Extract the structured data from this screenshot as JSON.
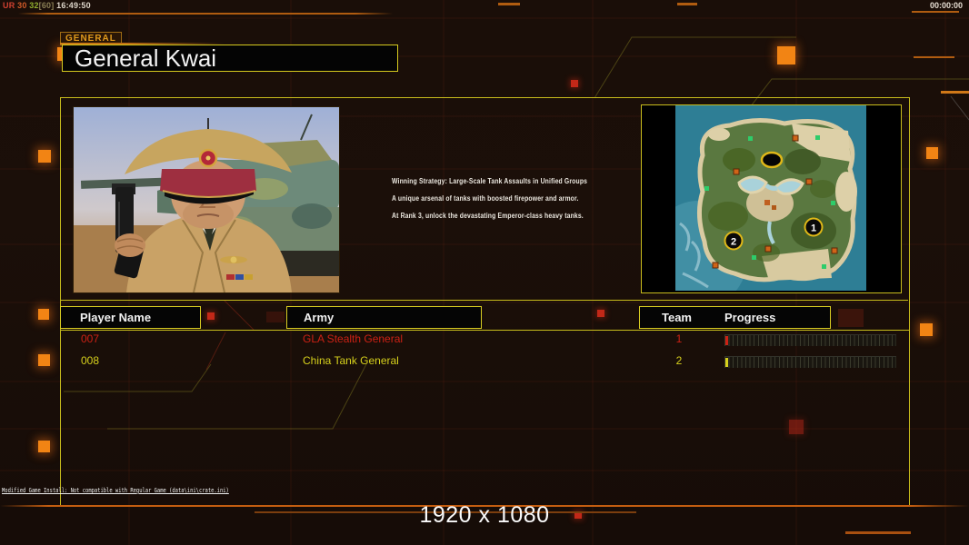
{
  "hud": {
    "debug": {
      "label1": "UR",
      "fps": "30",
      "value": "32",
      "max": "[60]",
      "clock": "16:49:50"
    },
    "match_timer": "00:00:00"
  },
  "header": {
    "tab": "GENERAL",
    "title": "General Kwai"
  },
  "briefing": {
    "lines": [
      "Winning Strategy: Large-Scale Tank Assaults in Unified Groups",
      "A unique arsenal of tanks with boosted firepower and armor.",
      "At Rank 3, unlock the devastating Emperor-class heavy tanks."
    ]
  },
  "map_preview": {
    "marker1": "1",
    "marker2": "2"
  },
  "player_table": {
    "headers": {
      "name": "Player Name",
      "army": "Army",
      "team": "Team",
      "progress": "Progress"
    },
    "rows": [
      {
        "name": "007",
        "army": "GLA Stealth General",
        "team": "1",
        "color": "#cc2114",
        "progress_percent": 2
      },
      {
        "name": "008",
        "army": "China Tank General",
        "team": "2",
        "color": "#d6d01c",
        "progress_percent": 2
      }
    ]
  },
  "status_bar": {
    "message": "Modified Game Install: Not compatible with Regular Game (data\\ini\\crate.ini)"
  },
  "footer": {
    "resolution": "1920 x 1080"
  },
  "theme": {
    "frame_yellow": "#c8bc1c",
    "accent_orange": "#c35d10",
    "glow_orange": "#f28414"
  }
}
